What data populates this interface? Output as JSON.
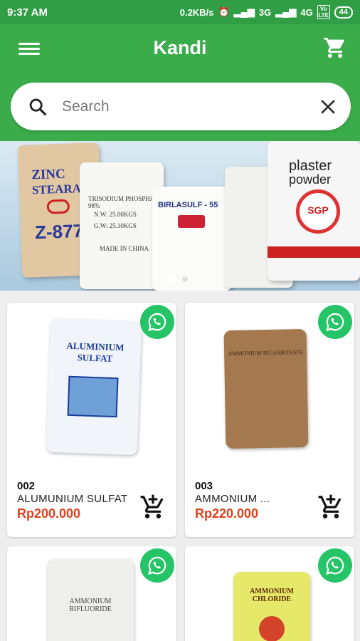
{
  "status": {
    "time": "9:37 AM",
    "net_speed": "0.2KB/s",
    "network": "3G",
    "network2": "4G",
    "volte": "Vo LTE",
    "battery": "44"
  },
  "appbar": {
    "title": "Kandi"
  },
  "search": {
    "placeholder": "Search"
  },
  "banner": {
    "sack1_line1": "ZINC",
    "sack1_line2": "STEARATE",
    "sack1_model": "Z-877",
    "sack2_line1": "TRISODIUM PHOSPHATE 98%",
    "sack2_line2": "N.W: 25.00KGS",
    "sack2_line3": "G.W: 25.10KGS",
    "sack2_line4": "MADE IN CHINA",
    "sack3_title": "BIRLASULF - 55",
    "sack5_line1": "plaster",
    "sack5_line2": "powder",
    "sack5_logo": "SGP",
    "slides": 2,
    "active_slide": 0
  },
  "products": [
    {
      "code": "002",
      "name": "ALUMUNIUM SULFAT",
      "price": "Rp200.000",
      "sack_text": "ALUMINIUM SULFAT",
      "sack_color": "#f1f4f8"
    },
    {
      "code": "003",
      "name": "AMMONIUM ...",
      "price": "Rp220.000",
      "sack_text": "AMMONIUM BICARBONATE",
      "sack_color": "#a5794f"
    },
    {
      "code": "",
      "name": "",
      "price": "",
      "sack_text": "AMMONIUM BIFLUORIDE",
      "sack_color": "#eeeeec"
    },
    {
      "code": "",
      "name": "",
      "price": "",
      "sack_text": "AMMONIUM CHLORIDE",
      "sack_color": "#e6e86a"
    }
  ],
  "colors": {
    "primary": "#3aac4a",
    "whatsapp": "#25c466",
    "price": "#e2401c"
  }
}
